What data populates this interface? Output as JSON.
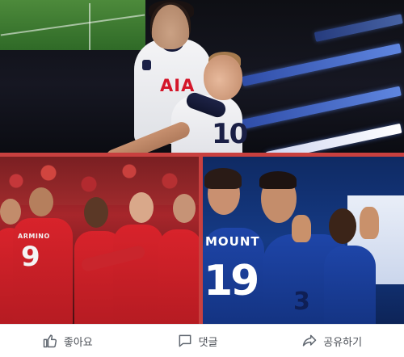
{
  "photos": {
    "top": {
      "sponsor_text": "AIA",
      "shirt_number": "10"
    },
    "bottom_left": {
      "shirt_name": "ARMINO",
      "shirt_number": "9"
    },
    "bottom_right": {
      "shirt_name": "MOUNT",
      "shirt_number": "19",
      "chest_number": "3"
    }
  },
  "divider_color": "#c8403f",
  "actions": {
    "like": {
      "label": "좋아요",
      "icon": "thumbs-up-icon"
    },
    "comment": {
      "label": "댓글",
      "icon": "comment-bubble-icon"
    },
    "share": {
      "label": "공유하기",
      "icon": "share-arrow-icon"
    }
  }
}
